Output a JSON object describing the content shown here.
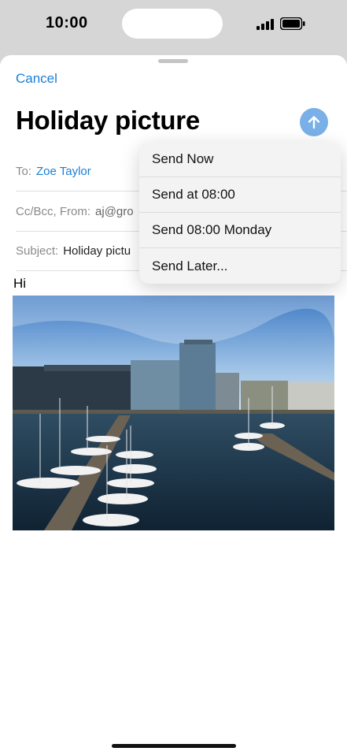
{
  "status_bar": {
    "time": "10:00"
  },
  "header": {
    "cancel_label": "Cancel",
    "title": "Holiday picture"
  },
  "fields": {
    "to_label": "To:",
    "to_value": "Zoe Taylor",
    "ccbcc_label": "Cc/Bcc, From:",
    "ccbcc_value": "aj@gro",
    "subject_label": "Subject:",
    "subject_value": "Holiday pictu"
  },
  "body": {
    "text": "Hi"
  },
  "send_menu": {
    "items": [
      {
        "label": "Send Now"
      },
      {
        "label": "Send at 08:00"
      },
      {
        "label": "Send 08:00 Monday"
      },
      {
        "label": "Send Later..."
      }
    ]
  },
  "colors": {
    "accent": "#1a7fd4",
    "send_button": "#7ab0e8",
    "phone_frame": "#d6d6d6"
  },
  "icons": {
    "send": "arrow-up-icon",
    "signal": "cellular-signal-icon",
    "battery": "battery-icon"
  }
}
